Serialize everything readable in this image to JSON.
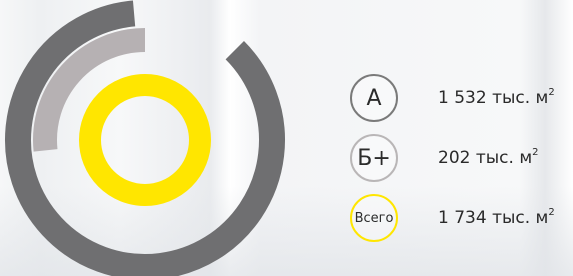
{
  "chart_data": {
    "type": "pie",
    "variant": "concentric-rings",
    "series": [
      {
        "name": "А",
        "value": 1532,
        "color": "#6f6f71",
        "ring": "outer"
      },
      {
        "name": "Б+",
        "value": 202,
        "color": "#b6b1b3",
        "ring": "middle"
      },
      {
        "name": "Всего",
        "value": 1734,
        "color": "#ffe600",
        "ring": "inner"
      }
    ],
    "total": 1734
  },
  "legend": [
    {
      "badge": "А",
      "value_text": "1 532 тыс. м",
      "sup": "2",
      "color": "#7a7a7a"
    },
    {
      "badge": "Б+",
      "value_text": "202 тыс. м",
      "sup": "2",
      "color": "#b9b6b7"
    },
    {
      "badge": "Всего",
      "value_text": "1 734 тыс. м",
      "sup": "2",
      "color": "#ffe600"
    }
  ]
}
